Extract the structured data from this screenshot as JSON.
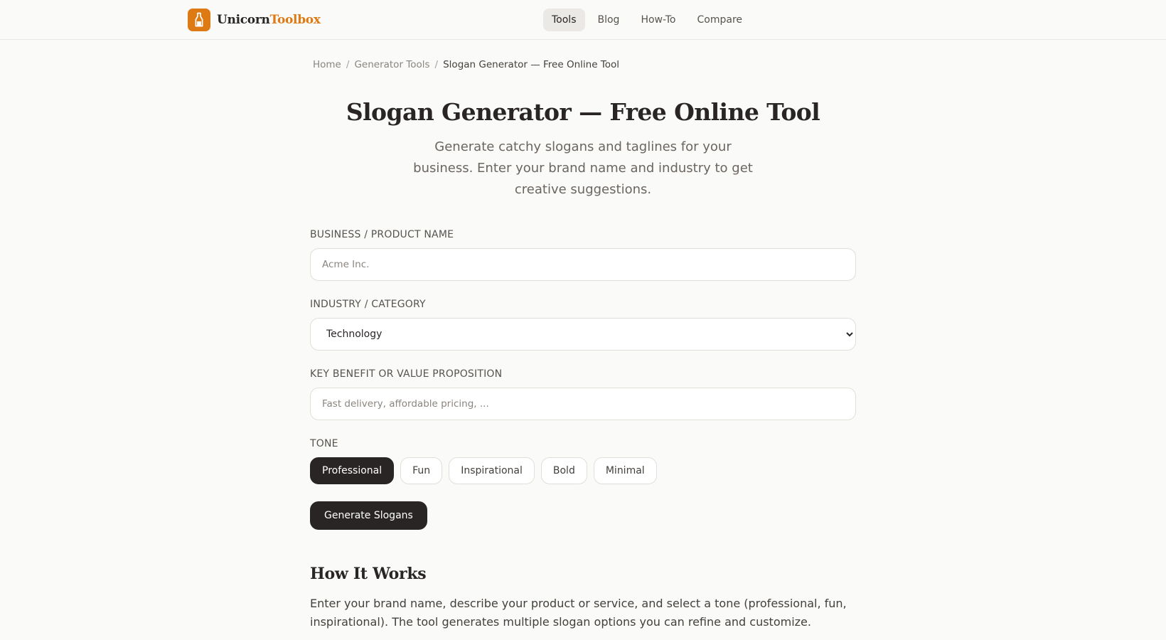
{
  "brand": {
    "name_part1": "Unicorn",
    "name_part2": "Toolbox",
    "logo_icon": "bottle-icon",
    "accent_color": "#de7a14"
  },
  "nav": {
    "items": [
      {
        "label": "Tools",
        "active": true
      },
      {
        "label": "Blog",
        "active": false
      },
      {
        "label": "How-To",
        "active": false
      },
      {
        "label": "Compare",
        "active": false
      }
    ]
  },
  "breadcrumb": {
    "items": [
      "Home",
      "Generator Tools",
      "Slogan Generator — Free Online Tool"
    ],
    "separator": "/"
  },
  "page": {
    "title": "Slogan Generator — Free Online Tool",
    "subtitle": "Generate catchy slogans and taglines for your business. Enter your brand name and industry to get creative suggestions."
  },
  "form": {
    "business_label": "BUSINESS / PRODUCT NAME",
    "business_placeholder": "Acme Inc.",
    "business_value": "",
    "industry_label": "INDUSTRY / CATEGORY",
    "industry_selected": "Technology",
    "benefit_label": "KEY BENEFIT OR VALUE PROPOSITION",
    "benefit_placeholder": "Fast delivery, affordable pricing, ...",
    "benefit_value": "",
    "tone_label": "TONE",
    "tones": [
      {
        "label": "Professional",
        "active": true
      },
      {
        "label": "Fun",
        "active": false
      },
      {
        "label": "Inspirational",
        "active": false
      },
      {
        "label": "Bold",
        "active": false
      },
      {
        "label": "Minimal",
        "active": false
      }
    ],
    "generate_label": "Generate Slogans"
  },
  "how_it_works": {
    "title": "How It Works",
    "text": "Enter your brand name, describe your product or service, and select a tone (professional, fun, inspirational). The tool generates multiple slogan options you can refine and customize."
  }
}
